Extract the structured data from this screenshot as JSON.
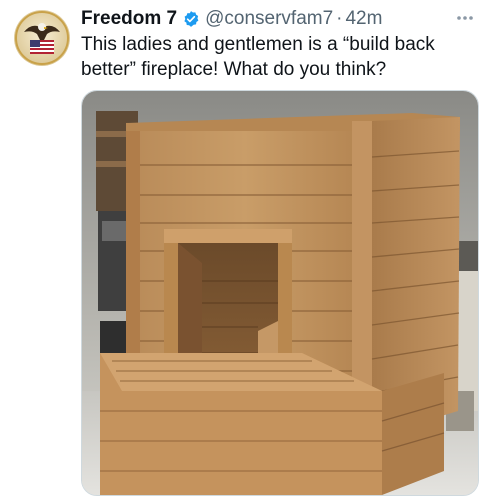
{
  "tweet": {
    "author_name": "Freedom 7",
    "handle": "@conservfam7",
    "separator": "·",
    "time": "42m",
    "text": "This ladies and gentlemen is a “build back better” fireplace! What do you think?"
  },
  "icons": {
    "verified": "verified-badge-icon",
    "more": "more-options-icon",
    "avatar": "eagle-flag-avatar"
  },
  "colors": {
    "name": "#0f1419",
    "secondary_text": "#536471",
    "verified_blue": "#1d9bf0",
    "media_border": "#cfd9de"
  },
  "media": {
    "subject": "wooden-pallet-fireplace-photo"
  }
}
